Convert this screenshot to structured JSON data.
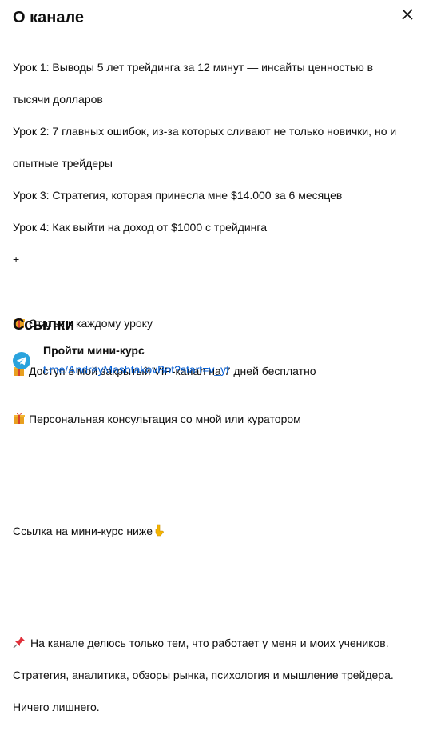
{
  "header": {
    "title": "О канале"
  },
  "description": {
    "lines": [
      "Урок 1: Выводы 5 лет трейдинга за 12 минут — инсайты ценностью в",
      "тысячи долларов",
      "Урок 2: 7 главных ошибок, из-за которых сливают не только новички, но и",
      "опытные трейдеры",
      "Урок 3: Стратегия, которая принесла мне $14.000 за 6 месяцев",
      "Урок 4: Как выйти на доход от $1000 с трейдинга",
      "+"
    ],
    "bonuses": [
      "Статья к каждому уроку",
      "Доступ в мой закрытый VIP-канал на 7 дней бесплатно",
      "Персональная консультация со мной или куратором"
    ],
    "course_link_text": "Ссылка на мини-курс ниже",
    "about_line1": "На канале делюсь только тем, что работает у меня и моих учеников.",
    "about_line2": "Стратегия, аналитика, обзоры рынка, психология и мышление трейдера.",
    "about_line3": "Ничего лишнего."
  },
  "links": {
    "title": "Ссылки",
    "items": [
      {
        "title": "Пройти мини-курс",
        "url": "t.me/AndreyMashtakovBot?start=v_yt",
        "icon": "telegram-icon"
      }
    ]
  },
  "icons": {
    "close": "close-icon",
    "gift": "gift-icon",
    "point_down": "point-down-icon",
    "pushpin": "pushpin-icon"
  },
  "colors": {
    "link": "#065fd4",
    "telegram": "#2aa3dd"
  }
}
